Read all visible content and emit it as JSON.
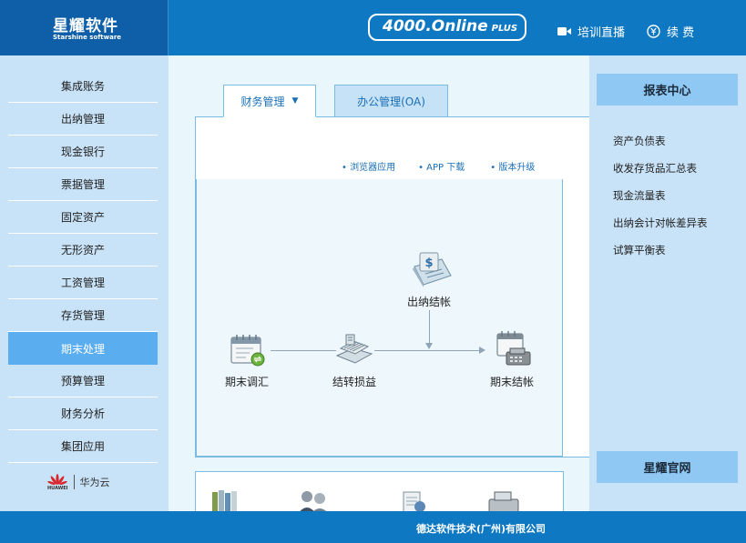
{
  "header": {
    "logo_title": "星耀软件",
    "logo_subtitle": "Starshine software",
    "brand": "4000.Online",
    "brand_suffix": "PLUS",
    "live_training": "培训直播",
    "renew": "续 费",
    "icons": {
      "live_training": "video-camera-icon",
      "renew": "yen-coin-icon"
    }
  },
  "sidebar": {
    "items": [
      {
        "label": "集成账务"
      },
      {
        "label": "出纳管理"
      },
      {
        "label": "现金银行"
      },
      {
        "label": "票据管理"
      },
      {
        "label": "固定资产"
      },
      {
        "label": "无形资产"
      },
      {
        "label": "工资管理"
      },
      {
        "label": "存货管理"
      },
      {
        "label": "期末处理",
        "active": true
      },
      {
        "label": "预算管理"
      },
      {
        "label": "财务分析"
      },
      {
        "label": "集团应用"
      }
    ],
    "partner_logo_text": "HUAWEI",
    "partner": "华为云"
  },
  "tabs": [
    {
      "label": "财务管理",
      "active": true
    },
    {
      "label": "办公管理(OA)",
      "active": false
    }
  ],
  "links": [
    "• 浏览器应用",
    "• APP 下载",
    "• 版本升级"
  ],
  "flow": {
    "nodes": [
      {
        "label": "出纳结帐",
        "icon": "cashier-close-icon"
      },
      {
        "label": "期末调汇",
        "icon": "calendar-exchange-icon"
      },
      {
        "label": "结转损益",
        "icon": "ledger-transfer-icon"
      },
      {
        "label": "期末结帐",
        "icon": "calendar-register-icon"
      }
    ]
  },
  "bottom_icons": [
    "binders-icon",
    "users-icon",
    "documents-icon",
    "cash-register-icon"
  ],
  "right": {
    "report_center": "报表中心",
    "reports": [
      "资产负债表",
      "收发存货品汇总表",
      "现金流量表",
      "出纳会计对帐差异表",
      "试算平衡表"
    ],
    "website": "星耀官网"
  },
  "footer": {
    "company": "德达软件技术(广州)有限公司"
  },
  "colors": {
    "header_blue": "#0f78c2",
    "sidebar_bg": "#c8e2f7",
    "active_item": "#5aaef0"
  }
}
